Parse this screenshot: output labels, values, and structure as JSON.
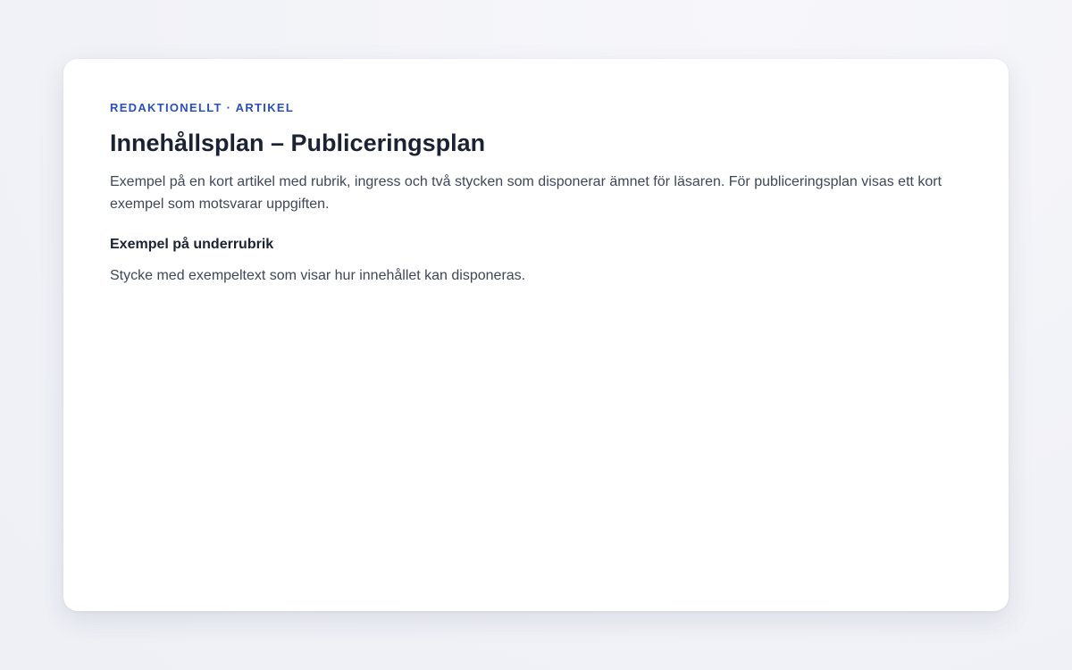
{
  "article": {
    "eyebrow": "REDAKTIONELLT · ARTIKEL",
    "title": "Innehållsplan – Publiceringsplan",
    "lead": "Exempel på en kort artikel med rubrik, ingress och två stycken som disponerar ämnet för läsaren. För publiceringsplan visas ett kort exempel som motsvarar uppgiften.",
    "subheading": "Exempel på underrubrik",
    "paragraph": "Stycke med exempeltext som visar hur innehållet kan disponeras."
  },
  "colors": {
    "accent": "#2b4fbf",
    "heading": "#1b2233",
    "body": "#3f4758",
    "background": "#f2f3f8",
    "card": "#ffffff"
  }
}
